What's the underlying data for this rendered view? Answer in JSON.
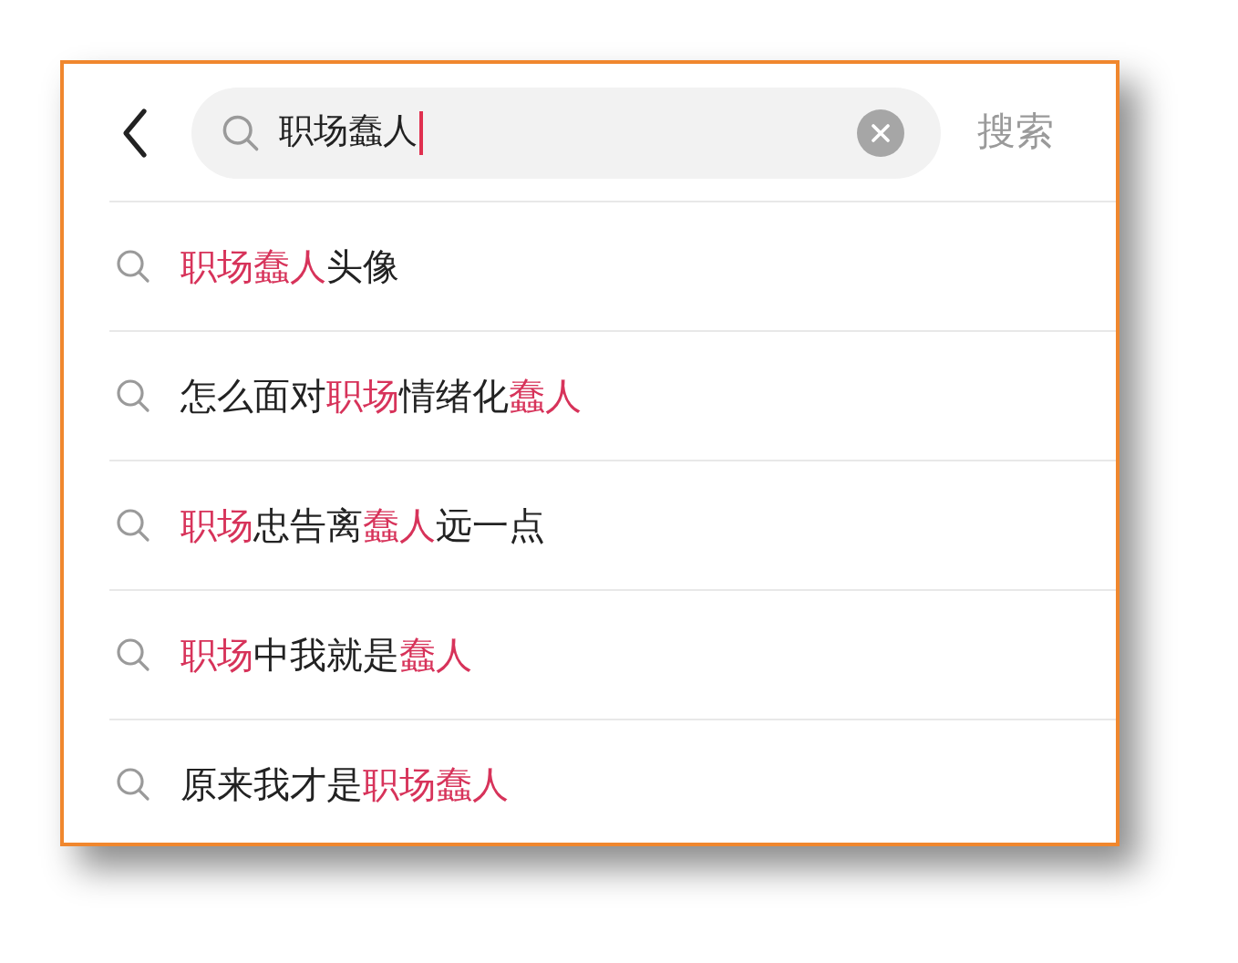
{
  "search": {
    "value": "职场蠢人",
    "focused": true,
    "action": "搜索"
  },
  "suggestions": [
    {
      "parts": [
        {
          "text": "职场蠢人",
          "highlight": true
        },
        {
          "text": "头像",
          "highlight": false
        }
      ]
    },
    {
      "parts": [
        {
          "text": "怎么面对",
          "highlight": false
        },
        {
          "text": "职场",
          "highlight": true
        },
        {
          "text": "情绪化",
          "highlight": false
        },
        {
          "text": "蠢人",
          "highlight": true
        }
      ]
    },
    {
      "parts": [
        {
          "text": "职场",
          "highlight": true
        },
        {
          "text": "忠告离",
          "highlight": false
        },
        {
          "text": "蠢人",
          "highlight": true
        },
        {
          "text": "远一点",
          "highlight": false
        }
      ]
    },
    {
      "parts": [
        {
          "text": "职场",
          "highlight": true
        },
        {
          "text": "中我就是",
          "highlight": false
        },
        {
          "text": "蠢人",
          "highlight": true
        }
      ]
    },
    {
      "parts": [
        {
          "text": "原来我才是",
          "highlight": false
        },
        {
          "text": "职场蠢人",
          "highlight": true
        }
      ]
    }
  ]
}
